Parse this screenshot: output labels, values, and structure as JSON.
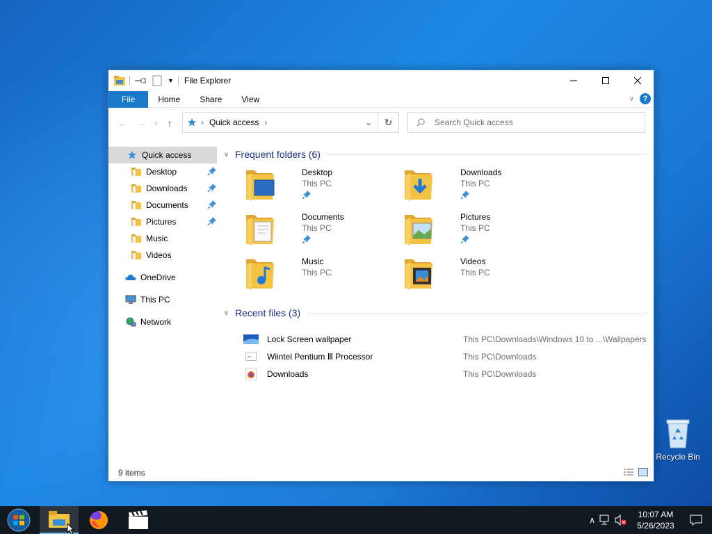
{
  "window": {
    "title": "File Explorer",
    "ribbon_tabs": [
      "File",
      "Home",
      "Share",
      "View"
    ]
  },
  "address": {
    "breadcrumb": "Quick access",
    "search_placeholder": "Search Quick access"
  },
  "sidebar": {
    "quick_access": "Quick access",
    "pinned": [
      {
        "label": "Desktop",
        "pinned": true
      },
      {
        "label": "Downloads",
        "pinned": true
      },
      {
        "label": "Documents",
        "pinned": true
      },
      {
        "label": "Pictures",
        "pinned": true
      },
      {
        "label": "Music",
        "pinned": false
      },
      {
        "label": "Videos",
        "pinned": false
      }
    ],
    "onedrive": "OneDrive",
    "this_pc": "This PC",
    "network": "Network"
  },
  "frequent": {
    "header": "Frequent folders (6)",
    "items": [
      {
        "name": "Desktop",
        "location": "This PC",
        "pinned": true,
        "icon": "desktop-folder-icon"
      },
      {
        "name": "Downloads",
        "location": "This PC",
        "pinned": true,
        "icon": "downloads-folder-icon"
      },
      {
        "name": "Documents",
        "location": "This PC",
        "pinned": true,
        "icon": "documents-folder-icon"
      },
      {
        "name": "Pictures",
        "location": "This PC",
        "pinned": true,
        "icon": "pictures-folder-icon"
      },
      {
        "name": "Music",
        "location": "This PC",
        "pinned": false,
        "icon": "music-folder-icon"
      },
      {
        "name": "Videos",
        "location": "This PC",
        "pinned": false,
        "icon": "videos-folder-icon"
      }
    ]
  },
  "recent": {
    "header": "Recent files (3)",
    "items": [
      {
        "name": "Lock Screen wallpaper",
        "path": "This PC\\Downloads\\Windows 10 to ...\\Wallpapers",
        "icon": "image-file-icon"
      },
      {
        "name": "Wiintel Pentium Ⅲ Processor",
        "path": "This PC\\Downloads",
        "icon": "file-icon"
      },
      {
        "name": "Downloads",
        "path": "This PC\\Downloads",
        "icon": "firefox-file-icon"
      }
    ]
  },
  "status": {
    "item_count": "9 items"
  },
  "desktop": {
    "recycle_bin": "Recycle Bin"
  },
  "taskbar": {
    "time": "10:07 AM",
    "date": "5/26/2023"
  },
  "colors": {
    "accent": "#1979ca",
    "section_heading": "#1e3287",
    "folder_yellow": "#f5c342"
  }
}
